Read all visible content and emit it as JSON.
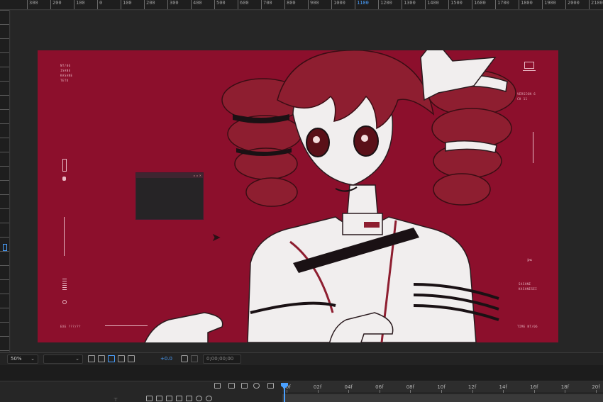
{
  "ruler": {
    "top_ticks": [
      "300",
      "200",
      "100",
      "0",
      "100",
      "200",
      "300",
      "400",
      "500",
      "600",
      "700",
      "800",
      "900",
      "1000",
      "1100",
      "1200",
      "1300",
      "1400",
      "1500",
      "1600",
      "1700",
      "1800",
      "1900",
      "2000",
      "2100",
      "2200"
    ],
    "highlight_index": 14
  },
  "artboard": {
    "color": "#8c0f2c",
    "hud": {
      "top_left": [
        "NT/06",
        "",
        "ISANE",
        "KASANE",
        "TETO"
      ],
      "top_right": [
        "VERSION 6",
        "CH 11"
      ],
      "right_mid": [
        "SASANE",
        "KASANESEI"
      ],
      "bottom_left": "EXE ???/??",
      "bottom_right": "TIME NT/06"
    }
  },
  "toolbar": {
    "zoom": "50%",
    "resolution": "",
    "exposure": "+0.0",
    "timecode": "0;00;00;00"
  },
  "timeline": {
    "frames": [
      "00f",
      "02f",
      "04f",
      "06f",
      "08f",
      "10f",
      "12f",
      "14f",
      "16f",
      "18f",
      "20f"
    ],
    "playhead_frame": 0
  },
  "colors": {
    "accent": "#4aa0ff",
    "background_red": "#8c0f2c",
    "hair_red": "#8e1e30"
  }
}
